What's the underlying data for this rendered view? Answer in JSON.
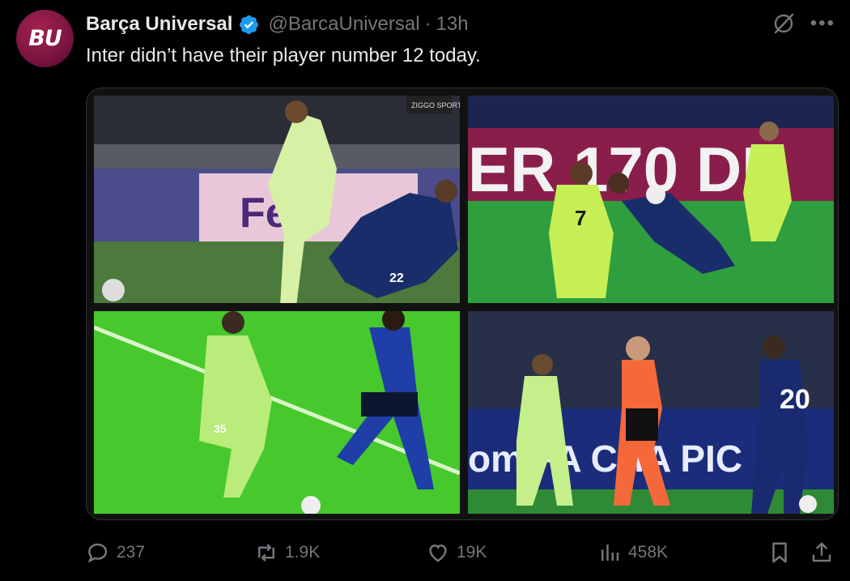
{
  "author": {
    "name": "Barça Universal",
    "handle": "@BarcaUniversal",
    "separator": "·",
    "time": "13h",
    "avatar_text": "BU",
    "verified": true
  },
  "tweet": {
    "text": "Inter didn’t have their player number 12 today."
  },
  "media": {
    "panels": [
      {
        "id": "top-left",
        "overlay_text": "Fed",
        "jersey_number": "22",
        "corner_logo": "ZIGGO SPORT"
      },
      {
        "id": "top-right",
        "overlay_text": "ER 170 DI",
        "jersey_number": "7"
      },
      {
        "id": "bottom-left",
        "jersey_number": "35"
      },
      {
        "id": "bottom-right",
        "overlay_text": "om  FA CHA  PIC",
        "jersey_number": "20"
      }
    ]
  },
  "actions": {
    "replies": "237",
    "reposts": "1.9K",
    "likes": "19K",
    "views": "458K"
  },
  "colors": {
    "background": "#000000",
    "text": "#e7e9ea",
    "muted": "#71767b",
    "verified": "#1d9bf0",
    "border": "#2f3336"
  },
  "icons": [
    "grok-icon",
    "more-icon",
    "reply-icon",
    "repost-icon",
    "like-icon",
    "views-icon",
    "bookmark-icon",
    "share-icon"
  ]
}
